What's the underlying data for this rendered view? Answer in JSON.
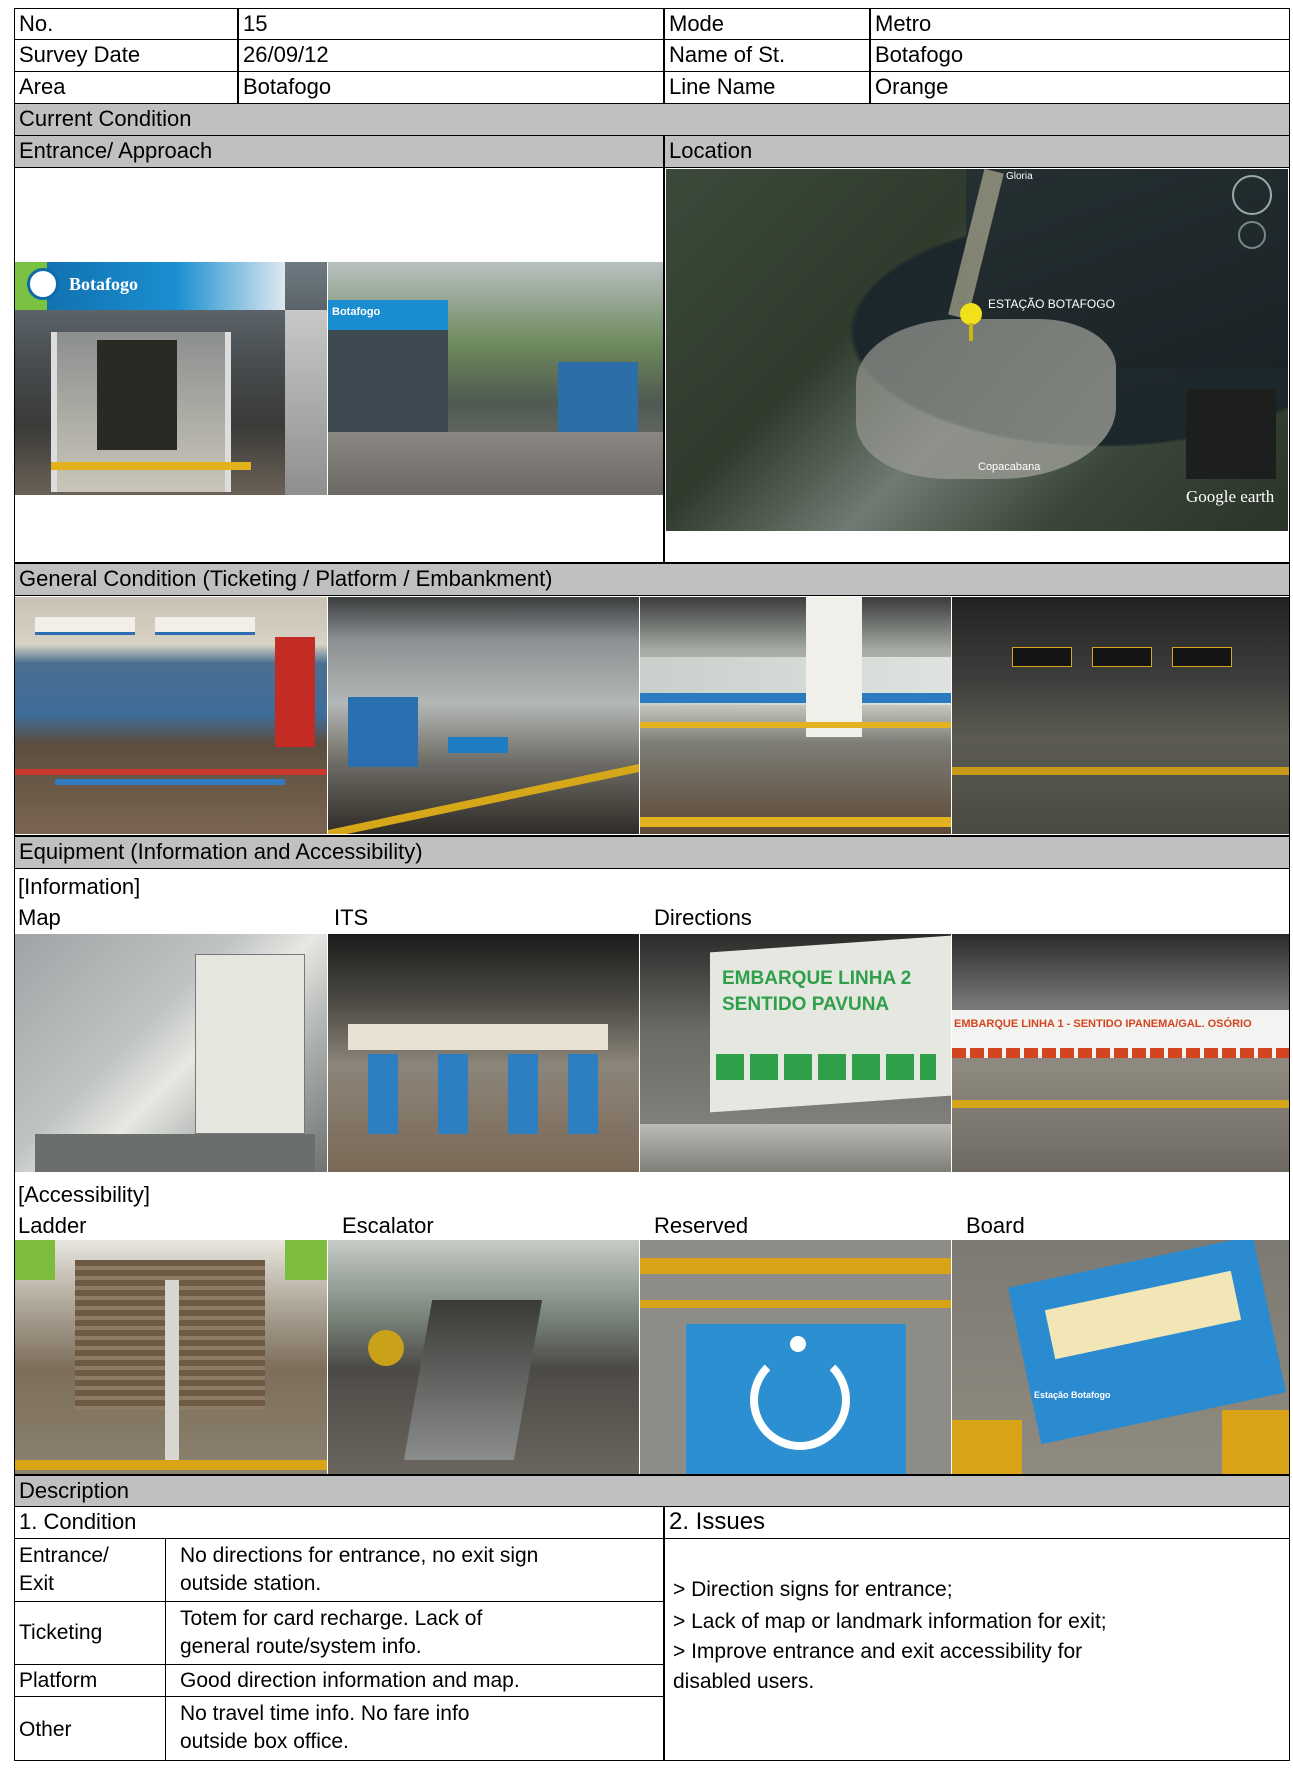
{
  "header": {
    "no_label": "No.",
    "no_value": "15",
    "mode_label": "Mode",
    "mode_value": "Metro",
    "date_label": "Survey Date",
    "date_value": "26/09/12",
    "station_label": "Name of St.",
    "station_value": "Botafogo",
    "area_label": "Area",
    "area_value": "Botafogo",
    "line_label": "Line Name",
    "line_value": "Orange"
  },
  "sections": {
    "current_condition": "Current Condition",
    "entrance_approach": "Entrance/ Approach",
    "location": "Location",
    "general_condition": "General Condition (Ticketing / Platform / Embankment)",
    "equipment": "Equipment (Information and Accessibility)",
    "description": "Description"
  },
  "entrance_photos": {
    "sign_text": "Botafogo",
    "sign_text_2": "Botafogo"
  },
  "map": {
    "station_label": "ESTAÇÃO BOTAFOGO",
    "gloria_label": "Gloria",
    "copacabana_label": "Copacabana",
    "brand": "Google earth"
  },
  "information": {
    "heading": "[Information]",
    "labels": [
      "Map",
      "ITS",
      "Directions"
    ],
    "directions_sign_line1": "EMBARQUE LINHA 2",
    "directions_sign_line2": "SENTIDO PAVUNA",
    "banner_text": "EMBARQUE LINHA 1 - SENTIDO IPANEMA/GAL. OSÓRIO"
  },
  "accessibility": {
    "heading": "[Accessibility]",
    "labels": [
      "Ladder",
      "Escalator",
      "Reserved",
      "Board"
    ],
    "board_sign": "Estação Botafogo"
  },
  "description": {
    "condition_title": "1.  Condition",
    "issues_title": "2.  Issues",
    "rows": [
      {
        "label_line1": "Entrance/",
        "label_line2": "Exit",
        "text_line1": "No directions for entrance, no exit sign",
        "text_line2": "outside station."
      },
      {
        "label_line1": "Ticketing",
        "label_line2": "",
        "text_line1": "Totem for card recharge.  Lack of",
        "text_line2": "general route/system info."
      },
      {
        "label_line1": "Platform",
        "label_line2": "",
        "text_line1": "Good direction information and map.",
        "text_line2": ""
      },
      {
        "label_line1": "Other",
        "label_line2": "",
        "text_line1": "No travel time info. No fare info",
        "text_line2": "outside box office."
      }
    ],
    "issues": [
      "> Direction signs for entrance;",
      "> Lack of map or landmark information for exit;",
      "> Improve  entrance and exit accessibility for",
      "disabled users."
    ]
  }
}
